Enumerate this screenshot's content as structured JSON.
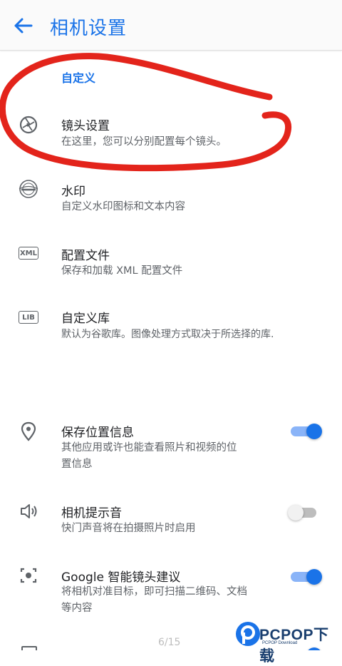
{
  "appbar": {
    "title": "相机设置",
    "back_icon": "arrow-back-icon"
  },
  "section": {
    "custom_header": "自定义"
  },
  "items": [
    {
      "title": "镜头设置",
      "subtitle": "在这里，您可以分别配置每个镜头。",
      "icon": "lens-aperture-icon"
    },
    {
      "title": "水印",
      "subtitle": "自定义水印图标和文本内容",
      "icon": "watermark-icon"
    },
    {
      "title": "配置文件",
      "subtitle": "保存和加载 XML 配置文件",
      "icon": "xml-icon",
      "icon_text": "XML"
    },
    {
      "title": "自定义库",
      "subtitle": "默认为谷歌库。图像处理方式取决于所选择的库.",
      "icon": "lib-icon",
      "icon_text": "LIB"
    },
    {
      "title": "保存位置信息",
      "subtitle_l1": "其他应用或许也能查看照片和视频的位",
      "subtitle_l2": "置信息",
      "icon": "location-pin-icon",
      "toggle": true
    },
    {
      "title": "相机提示音",
      "subtitle": "快门声音将在拍摄照片时启用",
      "icon": "volume-icon",
      "toggle": false
    },
    {
      "title": "Google 智能镜头建议",
      "subtitle_l1": "将相机对准目标，即可扫描二维码、文档",
      "subtitle_l2": "等内容",
      "icon": "lens-suggest-icon",
      "toggle": true
    }
  ],
  "page_indicator": "6/15",
  "watermark": {
    "brand": "PCPOP下载",
    "sub": "PCPOP Download"
  },
  "colors": {
    "accent": "#1a73e8",
    "annotation": "#e3241b"
  }
}
